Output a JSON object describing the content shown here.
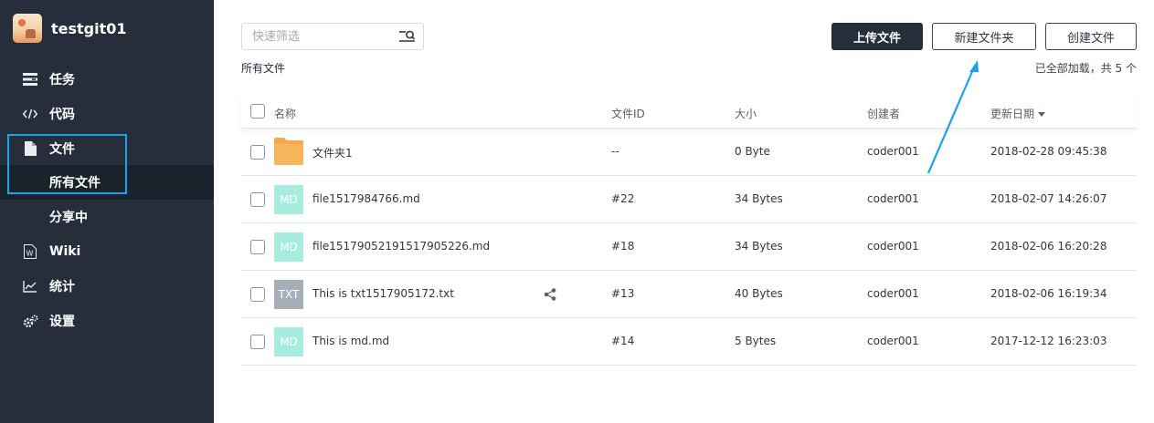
{
  "sidebar": {
    "brand_name": "testgit01",
    "items": [
      {
        "label": "任务",
        "icon": "task-list-icon"
      },
      {
        "label": "代码",
        "icon": "code-icon"
      },
      {
        "label": "文件",
        "icon": "file-icon"
      },
      {
        "label": "所有文件",
        "sub": true,
        "active": true
      },
      {
        "label": "分享中",
        "sub": true
      },
      {
        "label": "Wiki",
        "icon": "wiki-icon"
      },
      {
        "label": "统计",
        "icon": "chart-icon"
      },
      {
        "label": "设置",
        "icon": "settings-gears-icon"
      }
    ]
  },
  "toolbar": {
    "search_placeholder": "快速筛选",
    "upload_label": "上传文件",
    "new_folder_label": "新建文件夹",
    "create_file_label": "创建文件"
  },
  "breadcrumb": "所有文件",
  "loaded_status": "已全部加载，共 5 个",
  "table": {
    "headers": {
      "name": "名称",
      "id": "文件ID",
      "size": "大小",
      "creator": "创建者",
      "date": "更新日期"
    },
    "rows": [
      {
        "type": "folder",
        "name": "文件夹1",
        "id": "--",
        "size": "0 Byte",
        "creator": "coder001",
        "date": "2018-02-28 09:45:38"
      },
      {
        "type": "MD",
        "name": "file1517984766.md",
        "id": "#22",
        "size": "34 Bytes",
        "creator": "coder001",
        "date": "2018-02-07 14:26:07"
      },
      {
        "type": "MD",
        "name": "file15179052191517905226.md",
        "id": "#18",
        "size": "34 Bytes",
        "creator": "coder001",
        "date": "2018-02-06 16:20:28"
      },
      {
        "type": "TXT",
        "name": "This is txt1517905172.txt",
        "id": "#13",
        "size": "40 Bytes",
        "creator": "coder001",
        "date": "2018-02-06 16:19:34",
        "shared": true
      },
      {
        "type": "MD",
        "name": "This is md.md",
        "id": "#14",
        "size": "5 Bytes",
        "creator": "coder001",
        "date": "2017-12-12 16:23:03"
      }
    ]
  },
  "colors": {
    "sidebar_bg": "#252e3a",
    "highlight": "#19a3ea",
    "md_icon": "#a6ede0",
    "txt_icon": "#a6aeb8",
    "folder": "#f5a94a"
  }
}
